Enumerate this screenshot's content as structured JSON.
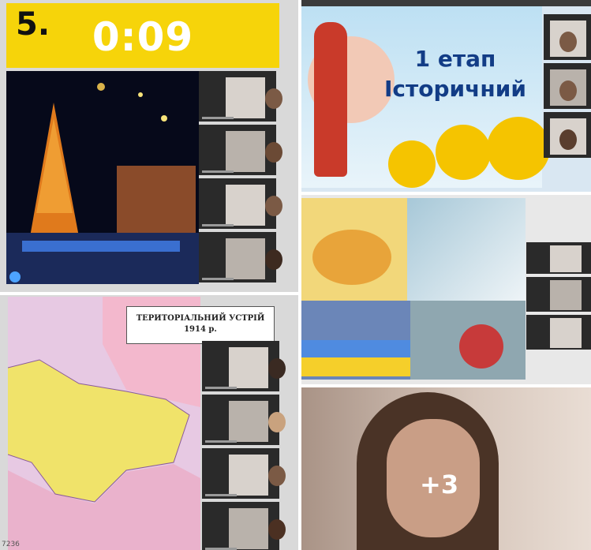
{
  "quiz": {
    "question_number": "5.",
    "timer": "0:09"
  },
  "stage": {
    "line1": "1 етап",
    "line2": "Історичний"
  },
  "map": {
    "title_line1": "ТЕРИТОРІАЛЬНИЙ УСТРІЙ",
    "title_line2": "1914 р.",
    "counter": "7236"
  },
  "participants": {
    "extra_count": "+3"
  },
  "colors": {
    "timer_bar": "#f6d40a",
    "stage_title": "#123c86",
    "map_pink": "#e7c9e3",
    "map_yellow": "#f0e36a"
  }
}
